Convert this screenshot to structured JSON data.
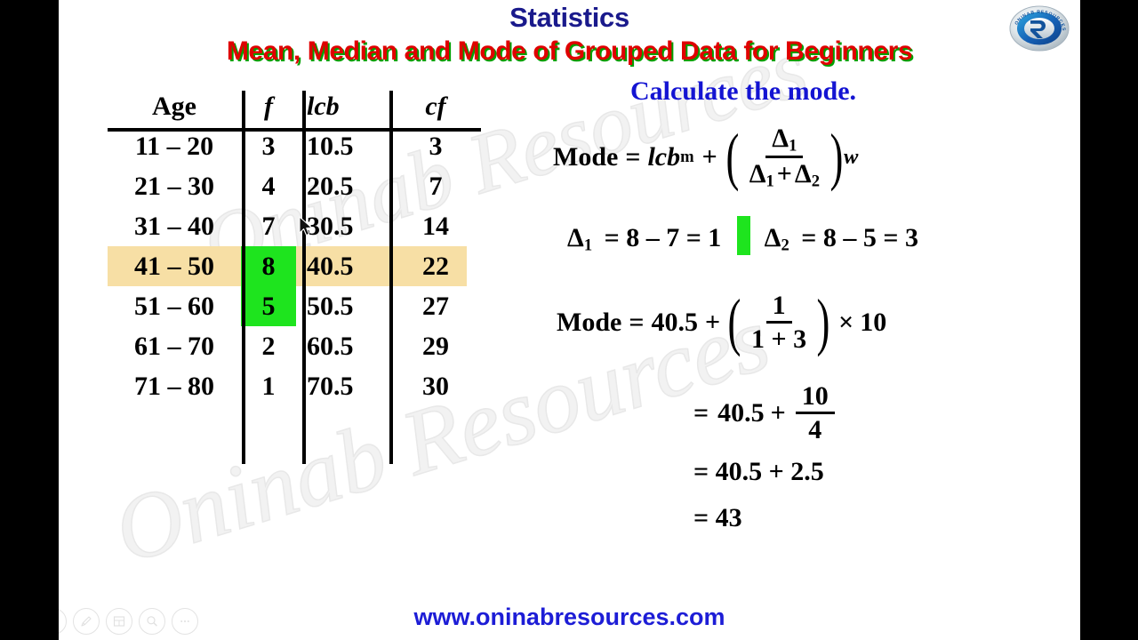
{
  "header": {
    "title": "Statistics",
    "subtitle": "Mean, Median and Mode of Grouped Data for Beginners",
    "title_color": "#1a1a8c",
    "subtitle_color": "#e00000",
    "subtitle_shadow_color": "#00a000"
  },
  "watermark": {
    "text": "Oninab Resources"
  },
  "logo": {
    "name": "oninab-resources-logo",
    "curved_text": "ONINAB RESOURCES",
    "letter": "R"
  },
  "table": {
    "headers": [
      "Age",
      "f",
      "lcb",
      "cf"
    ],
    "rows": [
      {
        "age": "11 – 20",
        "f": "3",
        "lcb": "10.5",
        "cf": "3"
      },
      {
        "age": "21 – 30",
        "f": "4",
        "lcb": "20.5",
        "cf": "7"
      },
      {
        "age": "31 – 40",
        "f": "7",
        "lcb": "30.5",
        "cf": "14"
      },
      {
        "age": "41 – 50",
        "f": "8",
        "lcb": "40.5",
        "cf": "22"
      },
      {
        "age": "51 – 60",
        "f": "5",
        "lcb": "50.5",
        "cf": "27"
      },
      {
        "age": "61 – 70",
        "f": "2",
        "lcb": "60.5",
        "cf": "29"
      },
      {
        "age": "71 – 80",
        "f": "1",
        "lcb": "70.5",
        "cf": "30"
      }
    ],
    "highlight_row_color": "#f7dfa5",
    "highlight_cell_color": "#1ee41e",
    "highlighted_row_index": 3,
    "green_highlighted_f_values": [
      "8",
      "5"
    ]
  },
  "solution": {
    "prompt": "Calculate the mode.",
    "prompt_color": "#1414d2",
    "formula": {
      "lhs": "Mode",
      "equals": "=",
      "term1": "lcb",
      "term1_sub": "m",
      "plus": "+",
      "frac_num": "Δ",
      "frac_num_sub": "1",
      "frac_den_left": "Δ",
      "frac_den_left_sub": "1",
      "frac_den_plus": "+",
      "frac_den_right": "Δ",
      "frac_den_right_sub": "2",
      "width_symbol": "w"
    },
    "deltas": {
      "d1_label": "Δ",
      "d1_sub": "1",
      "d1_expr": "= 8 – 7 = 1",
      "d2_label": "Δ",
      "d2_sub": "2",
      "d2_expr": "= 8 – 5 = 3",
      "separator_color": "#1ee41e"
    },
    "mode_calc": {
      "lhs": "Mode",
      "equals": "=",
      "lcb_value": "40.5",
      "plus": "+",
      "frac_num": "1",
      "frac_den": "1 + 3",
      "times": "×",
      "width_value": "10"
    },
    "step1": {
      "equals": "=",
      "value": "40.5",
      "plus": "+",
      "frac_num": "10",
      "frac_den": "4"
    },
    "step2": "= 40.5 + 2.5",
    "step3": "= 43"
  },
  "footer": {
    "url": "www.oninabresources.com",
    "url_color": "#1d1dd6"
  },
  "controls": [
    {
      "name": "previous-slide-button",
      "icon": "triangle-left-icon"
    },
    {
      "name": "next-slide-button",
      "icon": "triangle-right-icon"
    },
    {
      "name": "pen-tool-button",
      "icon": "pen-icon"
    },
    {
      "name": "slide-grid-button",
      "icon": "grid-icon"
    },
    {
      "name": "zoom-button",
      "icon": "magnifier-icon"
    },
    {
      "name": "more-options-button",
      "icon": "ellipsis-icon"
    }
  ]
}
